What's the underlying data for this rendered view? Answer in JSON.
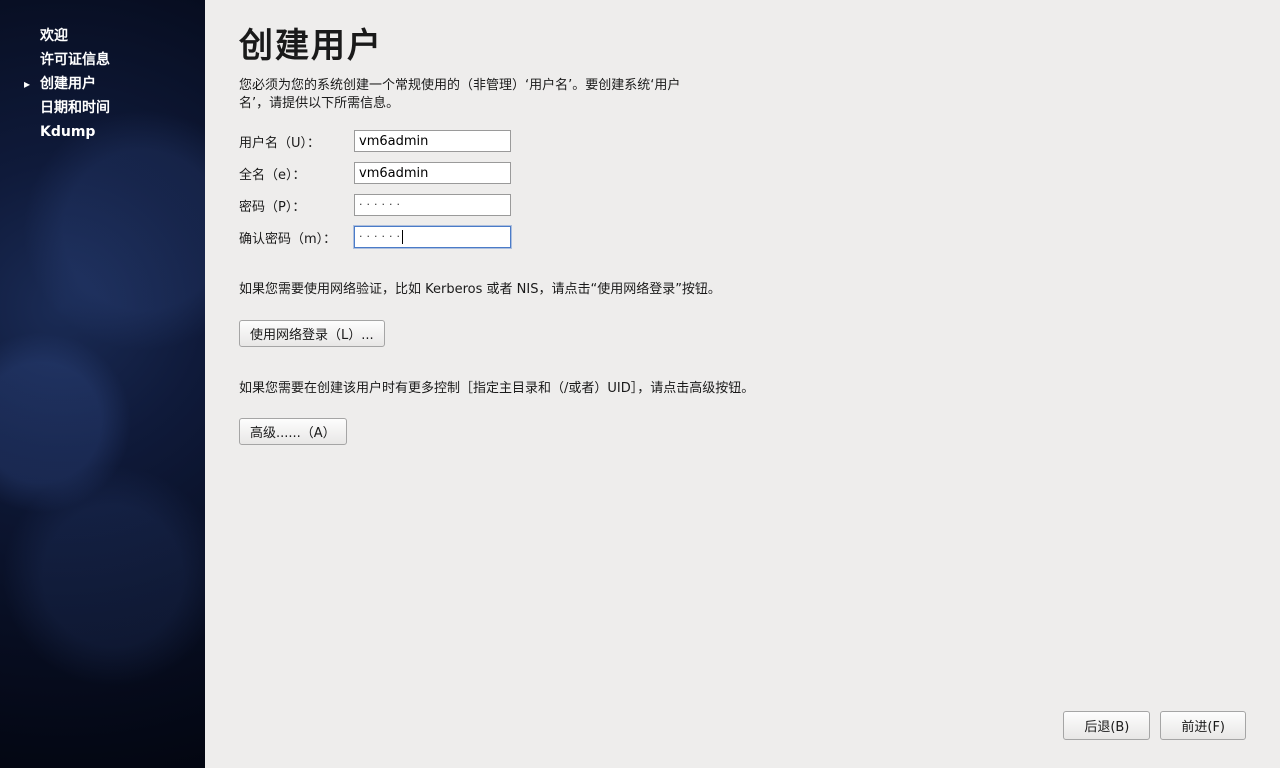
{
  "sidebar": {
    "items": [
      {
        "label": "欢迎",
        "current": false
      },
      {
        "label": "许可证信息",
        "current": false
      },
      {
        "label": "创建用户",
        "current": true
      },
      {
        "label": "日期和时间",
        "current": false
      },
      {
        "label": "Kdump",
        "current": false
      }
    ]
  },
  "page": {
    "title": "创建用户",
    "intro": "您必须为您的系统创建一个常规使用的（非管理）‘用户名’。要创建系统‘用户名’，请提供以下所需信息。"
  },
  "form": {
    "username_label": "用户名（U）：",
    "username_value": "vm6admin",
    "fullname_label": "全名（e）：",
    "fullname_value": "vm6admin",
    "password_label": "密码（P）：",
    "password_value": "······",
    "confirm_label": "确认密码（m）：",
    "confirm_value": "······"
  },
  "network_note": "如果您需要使用网络验证，比如 Kerberos 或者 NIS，请点击“使用网络登录”按钮。",
  "network_button": "使用网络登录（L）...",
  "advanced_note": "如果您需要在创建该用户时有更多控制［指定主目录和（/或者）UID］，请点击高级按钮。",
  "advanced_button": "高级......（A）",
  "footer": {
    "back": "后退(B)",
    "forward": "前进(F)"
  }
}
